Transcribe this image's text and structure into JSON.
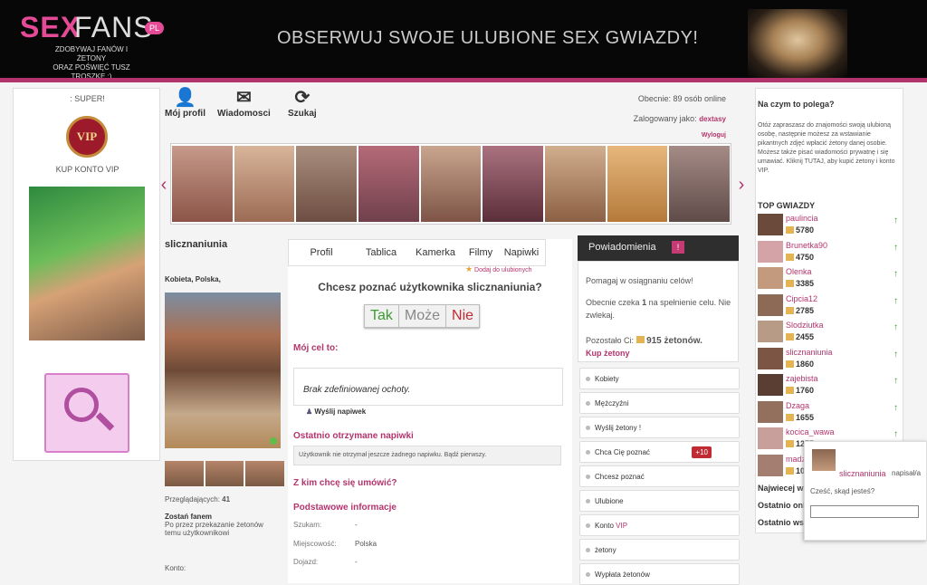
{
  "header": {
    "logo_sex": "SEX",
    "logo_fans": "FANS",
    "logo_pl": "PL",
    "logo_sub_line1": "ZDOBYWAJ FANÓW I ŻETONY",
    "logo_sub_line2": "ORAZ POŚWIĘĆ TUSZ TROSZKĘ ;)",
    "title": "OBSERWUJ SWOJE ULUBIONE SEX GWIAZDY!"
  },
  "left": {
    "super": ": SUPER!",
    "vip": "VIP",
    "vip_label": "KUP KONTO VIP"
  },
  "toolbar": {
    "profile": "Mój profil",
    "messages": "Wiadomosci",
    "search": "Szukaj"
  },
  "status": {
    "online": "Obecnie: 89 osób online",
    "logged_prefix": "Zalogowany jako:",
    "logged_user": "dextasy",
    "logout": "Wyloguj"
  },
  "profile": {
    "name": "slicznaniunia",
    "sex": "Kobieta, Polska,",
    "viewers_label": "Przeglądających:",
    "viewers": "41",
    "fan_title": "Zostań fanem",
    "fan_text": "Po przez przekazanie żetonów temu użytkownikowi",
    "konto": "Konto:"
  },
  "tabs": [
    "Profil",
    "Tablica",
    "Kamerka",
    "Filmy",
    "Napiwki"
  ],
  "center": {
    "fav": "Dodaj do ulubionych",
    "meet": "Chcesz poznać użytkownika slicznaniunia?",
    "yes": "Tak",
    "maybe": "Może",
    "no": "Nie",
    "goal_title": "Mój cel to:",
    "no_goal": "Brak zdefiniowanej ochoty.",
    "send_tip": "Wyślij napiwek",
    "last_tips": "Ostatnio otrzymane napiwki",
    "no_tips": "Użytkownik nie otrzymał jeszcze żadnego napiwku. Bądź pierwszy.",
    "who_meet": "Z kim chcę się umówić?",
    "basic": "Podstawowe informacje",
    "rows": [
      {
        "k": "Szukam:",
        "v": "-"
      },
      {
        "k": "Miejscowość:",
        "v": "Polska"
      },
      {
        "k": "Dojazd:",
        "v": "-"
      }
    ]
  },
  "notif": {
    "title": "Powiadomienia",
    "bell": "!",
    "t1": "Pomagaj w osiągnaniu celów!",
    "t2a": "Obecnie czeka",
    "t2b": "1",
    "t2c": "na spełnienie celu. Nie zwlekaj.",
    "t3a": "Pozostało Ci:",
    "t3b": "915 żetonów.",
    "buy": "Kup żetony"
  },
  "menu": [
    {
      "label": "Kobiety"
    },
    {
      "label": "Mężczyźni"
    },
    {
      "label": "Wyślij żetony !"
    },
    {
      "label": "Chca Cię poznać",
      "badge": "+10"
    },
    {
      "label": "Chcesz poznać"
    },
    {
      "label": "Ulubione"
    },
    {
      "label": "Konto",
      "extra": "VIP"
    },
    {
      "label": "żetony"
    },
    {
      "label": "Wypłata żetonów"
    }
  ],
  "right": {
    "title": "Na czym to polega?",
    "desc": "Otóż zapraszasz do znajomości swoją ulubioną osobę, następnie możesz za wstawianie pikantnych zdjęć wpłacić żetony danej osobie. Możesz także pisać wiadomości prywatnę i się umawiać. Kliknij TUTAJ, aby kupić żetony i konto VIP.",
    "top": "TOP GWIAZDY",
    "stars": [
      {
        "name": "paulincia",
        "pts": "5780"
      },
      {
        "name": "Brunetka90",
        "pts": "4750"
      },
      {
        "name": "Olenka",
        "pts": "3385"
      },
      {
        "name": "Cipcia12",
        "pts": "2785"
      },
      {
        "name": "Slodziutka",
        "pts": "2455"
      },
      {
        "name": "slicznaniunia",
        "pts": "1860"
      },
      {
        "name": "zajebista",
        "pts": "1760"
      },
      {
        "name": "Dzaga",
        "pts": "1655"
      },
      {
        "name": "kocica_wawa",
        "pts": "1275"
      },
      {
        "name": "madzia",
        "pts": "1030"
      }
    ],
    "link1": "Najwiecej wyświetleń",
    "link2": "Ostatnio online",
    "link3": "Ostatnio wstawili"
  },
  "chat": {
    "name": "slicznaniunia",
    "wrote": "napisał/a",
    "msg": "Cześć, skąd jesteś?"
  }
}
